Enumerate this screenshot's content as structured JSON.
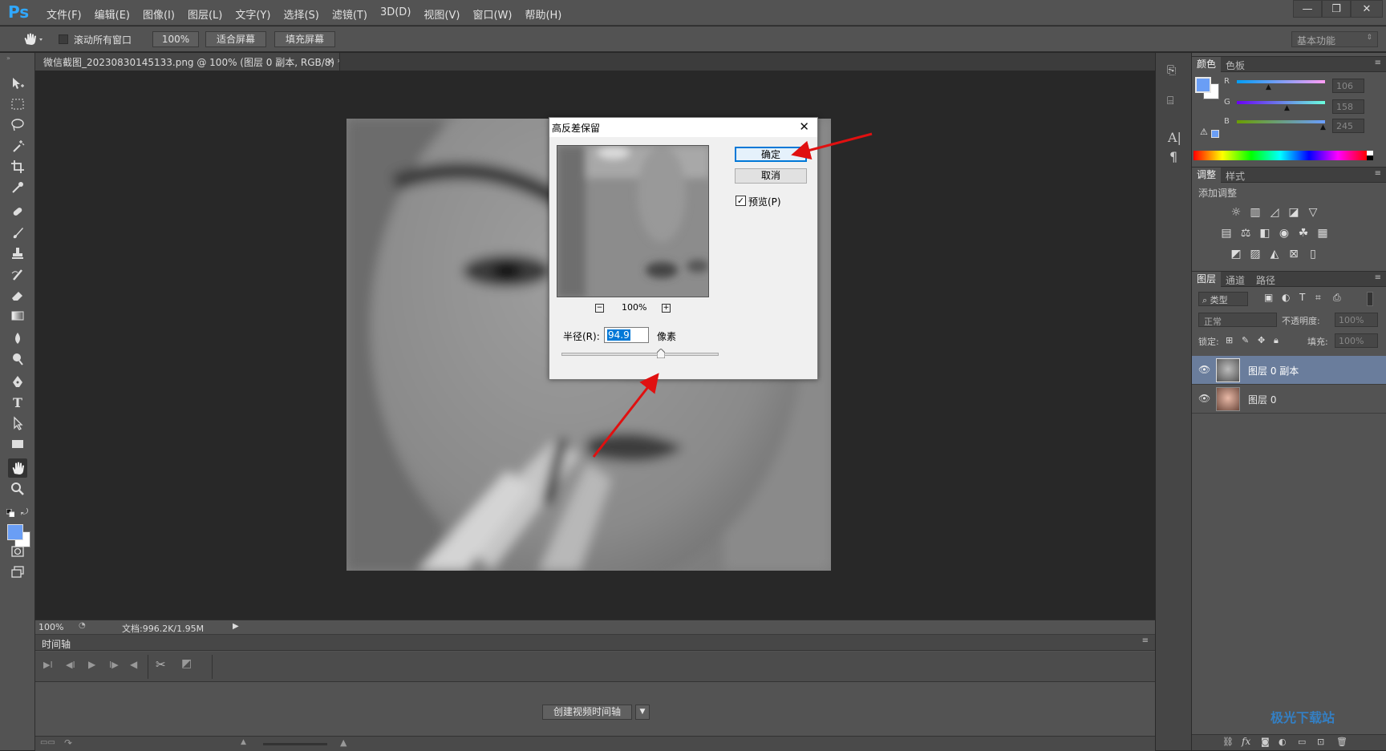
{
  "app": {
    "logo": "Ps"
  },
  "menu": [
    "文件(F)",
    "编辑(E)",
    "图像(I)",
    "图层(L)",
    "文字(Y)",
    "选择(S)",
    "滤镜(T)",
    "3D(D)",
    "视图(V)",
    "窗口(W)",
    "帮助(H)"
  ],
  "window_controls": {
    "minimize": "—",
    "restore": "❐",
    "close": "✕"
  },
  "options": {
    "scroll_all_label": "滚动所有窗口",
    "zoom_100": "100%",
    "fit_screen": "适合屏幕",
    "fill_screen": "填充屏幕",
    "workspace": "基本功能"
  },
  "document": {
    "tab_title": "微信截图_20230830145133.png @ 100% (图层 0 副本, RGB/8) *",
    "tab_close": "×",
    "zoom": "100%",
    "doc_info": "文档:996.2K/1.95M"
  },
  "timeline": {
    "title": "时间轴",
    "create_button": "创建视频时间轴"
  },
  "color_panel": {
    "tabs": [
      "颜色",
      "色板"
    ],
    "channels": [
      {
        "label": "R",
        "value": "106"
      },
      {
        "label": "G",
        "value": "158"
      },
      {
        "label": "B",
        "value": "245"
      }
    ],
    "foreground_color": "#6a9ef5",
    "background_color": "#ffffff"
  },
  "adjust_panel": {
    "tabs": [
      "调整",
      "样式"
    ],
    "subtitle": "添加调整"
  },
  "layers_panel": {
    "tabs": [
      "图层",
      "通道",
      "路径"
    ],
    "filter_type": "类型",
    "blend_mode": "正常",
    "opacity_label": "不透明度:",
    "opacity_value": "100%",
    "lock_label": "锁定:",
    "fill_label": "填充:",
    "fill_value": "100%",
    "layers": [
      {
        "name": "图层 0 副本",
        "selected": true
      },
      {
        "name": "图层 0",
        "selected": false
      }
    ]
  },
  "dialog": {
    "title": "高反差保留",
    "ok": "确定",
    "cancel": "取消",
    "preview_label": "预览(P)",
    "preview_checked": true,
    "zoom": "100%",
    "radius_label": "半径(R):",
    "radius_value": "94.9",
    "radius_unit": "像素",
    "radius_slider_fraction": 0.63
  },
  "watermark": "极光下载站"
}
